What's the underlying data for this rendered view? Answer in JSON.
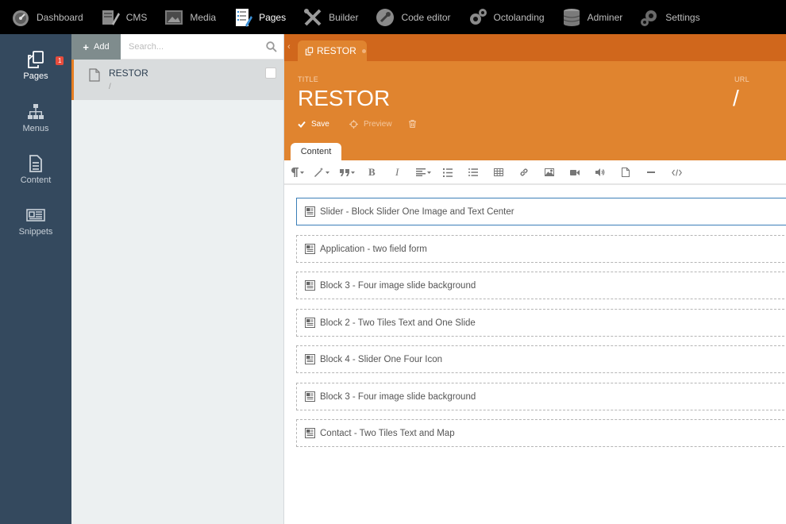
{
  "topnav": {
    "items": [
      {
        "label": "Dashboard",
        "icon": "dashboard-icon"
      },
      {
        "label": "CMS",
        "icon": "cms-icon"
      },
      {
        "label": "Media",
        "icon": "media-icon"
      },
      {
        "label": "Pages",
        "icon": "pages-icon",
        "active": true
      },
      {
        "label": "Builder",
        "icon": "builder-icon"
      },
      {
        "label": "Code editor",
        "icon": "code-editor-icon"
      },
      {
        "label": "Octolanding",
        "icon": "octolanding-icon"
      },
      {
        "label": "Adminer",
        "icon": "adminer-icon"
      },
      {
        "label": "Settings",
        "icon": "settings-icon"
      }
    ]
  },
  "sidebar": {
    "badge": "1",
    "items": [
      {
        "label": "Pages",
        "icon": "pages-copy-icon",
        "active": true
      },
      {
        "label": "Menus",
        "icon": "sitemap-icon"
      },
      {
        "label": "Content",
        "icon": "file-text-icon"
      },
      {
        "label": "Snippets",
        "icon": "newspaper-icon"
      }
    ]
  },
  "list": {
    "add_label": "Add",
    "search_placeholder": "Search...",
    "rows": [
      {
        "title": "RESTOR",
        "url": "/"
      }
    ]
  },
  "editor": {
    "tab_label": "RESTOR",
    "title_label": "TITLE",
    "title_value": "RESTOR",
    "url_label": "URL",
    "url_value": "/",
    "save_label": "Save",
    "preview_label": "Preview",
    "content_tab": "Content"
  },
  "toolbar_buttons": [
    "paragraph-format",
    "magic-style",
    "quote",
    "bold",
    "italic",
    "align",
    "ordered-list",
    "unordered-list",
    "table",
    "link",
    "image",
    "video",
    "audio",
    "file",
    "horizontal-line",
    "code-view"
  ],
  "blocks": [
    "Slider - Block Slider One Image and Text Center",
    "Application - two field form",
    "Block 3 - Four image slide background",
    "Block 2 - Two Tiles Text and One Slide",
    "Block 4 - Slider One Four Icon",
    "Block 3 - Four image slide background",
    "Contact - Two Tiles Text and Map"
  ],
  "colors": {
    "accent": "#e0842f",
    "tabstrip": "#d0671c",
    "sidebar": "#34495e",
    "topbar": "#000000"
  }
}
